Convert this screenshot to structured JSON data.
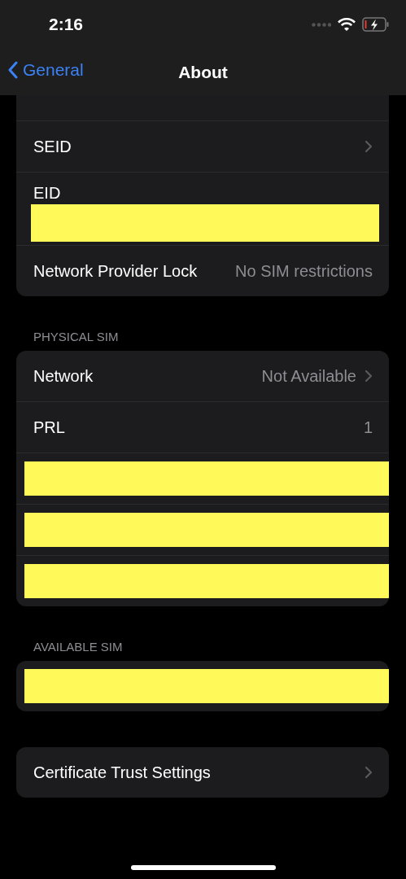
{
  "status_bar": {
    "time": "2:16"
  },
  "nav": {
    "back": "General",
    "title": "About"
  },
  "sections": [
    {
      "rows": [
        {
          "kind": "cut"
        },
        {
          "kind": "link",
          "label": "SEID"
        },
        {
          "kind": "stacked",
          "label": "EID"
        },
        {
          "kind": "value",
          "label": "Network Provider Lock",
          "value": "No SIM restrictions"
        }
      ]
    },
    {
      "header": "PHYSICAL SIM",
      "rows": [
        {
          "kind": "link",
          "label": "Network",
          "value": "Not Available"
        },
        {
          "kind": "value",
          "label": "PRL",
          "value": "1"
        },
        {
          "kind": "redacted"
        },
        {
          "kind": "redacted"
        },
        {
          "kind": "redacted"
        }
      ]
    },
    {
      "header": "AVAILABLE SIM",
      "rows": [
        {
          "kind": "redacted"
        }
      ]
    },
    {
      "rows": [
        {
          "kind": "link",
          "label": "Certificate Trust Settings"
        }
      ]
    }
  ]
}
